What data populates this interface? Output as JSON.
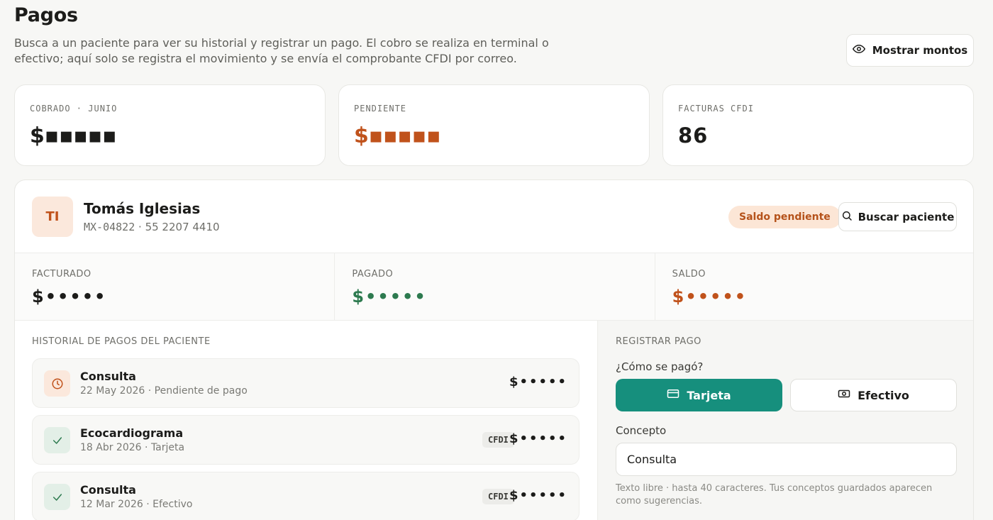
{
  "header": {
    "title": "Pagos",
    "description": "Busca a un paciente para ver su historial y registrar un pago. El cobro se realiza en terminal o efectivo; aquí solo se registra el movimiento y se envía el comprobante CFDI por correo.",
    "toggle_label": "Mostrar montos",
    "toggle_icon": "eye-icon"
  },
  "stats": [
    {
      "label": "COBRADO · JUNIO",
      "value": "$▪▪▪▪▪",
      "color": "#1c1c1a"
    },
    {
      "label": "PENDIENTE",
      "value": "$▪▪▪▪▪",
      "color": "#c0521b"
    },
    {
      "label": "FACTURAS CFDI",
      "value": "86",
      "color": "#1c1c1a"
    }
  ],
  "patient": {
    "initials": "TI",
    "name": "Tomás Iglesias",
    "id": "MX-04822",
    "phone": "55 2207 4410",
    "badge": "Saldo pendiente",
    "search_label": "Buscar paciente",
    "summary": [
      {
        "label": "FACTURADO",
        "value": "$•••••",
        "color": "#1c1c1a"
      },
      {
        "label": "PAGADO",
        "value": "$•••••",
        "color": "#2d7a4f"
      },
      {
        "label": "SALDO",
        "value": "$•••••",
        "color": "#c0521b"
      }
    ]
  },
  "history": {
    "label": "HISTORIAL DE PAGOS DEL PACIENTE",
    "rows": [
      {
        "title": "Consulta",
        "date": "22 May 2026",
        "status": "Pendiente de pago",
        "amount": "$•••••",
        "cfdi": "",
        "icon": "clock-icon"
      },
      {
        "title": "Ecocardiograma",
        "date": "18 Abr 2026",
        "status": "Tarjeta",
        "amount": "$•••••",
        "cfdi": "CFDI",
        "icon": "check-icon"
      },
      {
        "title": "Consulta",
        "date": "12 Mar 2026",
        "status": "Efectivo",
        "amount": "$•••••",
        "cfdi": "CFDI",
        "icon": "check-icon"
      }
    ]
  },
  "register": {
    "label": "REGISTRAR PAGO",
    "question": "¿Cómo se pagó?",
    "methods": [
      "Tarjeta",
      "Efectivo"
    ],
    "selected_method": "Tarjeta",
    "concept_label": "Concepto",
    "concept_value": "Consulta",
    "help": "Texto libre · hasta 40 caracteres. Tus conceptos guardados aparecen como sugerencias."
  },
  "colors": {
    "accent": "#168f7d",
    "warning": "#c0521b",
    "success": "#2d7a4f"
  }
}
